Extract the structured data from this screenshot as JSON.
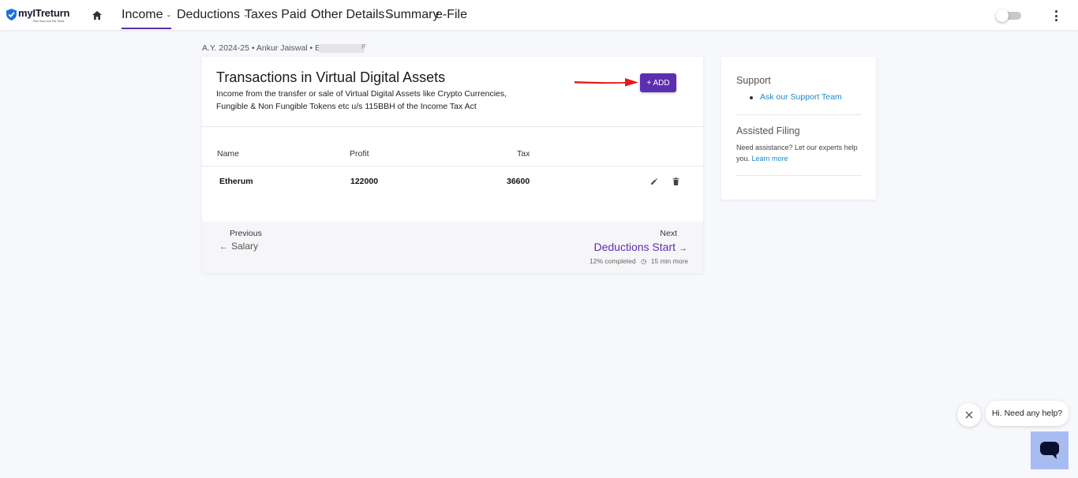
{
  "app": {
    "logo_text": "myITreturn",
    "logo_tagline": "Plan Save and File Taxes"
  },
  "nav": {
    "items": [
      {
        "label": "Income",
        "dropdown": true,
        "active": true
      },
      {
        "label": "Deductions",
        "dropdown": true
      },
      {
        "label": "Taxes Paid",
        "dropdown": true
      },
      {
        "label": "Other Details",
        "dropdown": true
      },
      {
        "label": "Summary",
        "dropdown": false
      },
      {
        "label": "e-File",
        "dropdown": false
      }
    ],
    "accent_color": "#5b2fb0"
  },
  "breadcrumb": {
    "text": "A.Y. 2024-25 • Ankur Jaiswal • E",
    "trailing_char": "P"
  },
  "section": {
    "title": "Transactions in Virtual Digital Assets",
    "description_line1": "Income from the transfer or sale of Virtual Digital Assets like Crypto Currencies,",
    "description_line2": "Fungible & Non Fungible Tokens etc u/s 115BBH of the Income Tax Act",
    "add_button": "+ ADD"
  },
  "table": {
    "headers": {
      "name": "Name",
      "profit": "Profit",
      "tax": "Tax"
    },
    "rows": [
      {
        "name": "Etherum",
        "profit": "122000",
        "tax": "36600"
      }
    ]
  },
  "footer": {
    "previous_label": "Previous",
    "previous_link": "Salary",
    "next_label": "Next",
    "next_link": "Deductions Start",
    "progress_text": "12% completed",
    "time_text": "15 min more"
  },
  "sidebar": {
    "support_title": "Support",
    "support_link": "Ask our Support Team",
    "assisted_title": "Assisted Filing",
    "assisted_text": "Need assistance? Let our experts help you.",
    "assisted_link": "Learn more"
  },
  "chat": {
    "greeting": "Hi. Need any help?"
  },
  "icons": [
    "home-icon",
    "chevron-down-icon",
    "toggle-switch",
    "more-vertical-icon",
    "red-arrow-annotation",
    "edit-pencil-icon",
    "trash-icon",
    "arrow-left-icon",
    "arrow-right-icon",
    "clock-icon",
    "close-icon",
    "chat-icon"
  ]
}
